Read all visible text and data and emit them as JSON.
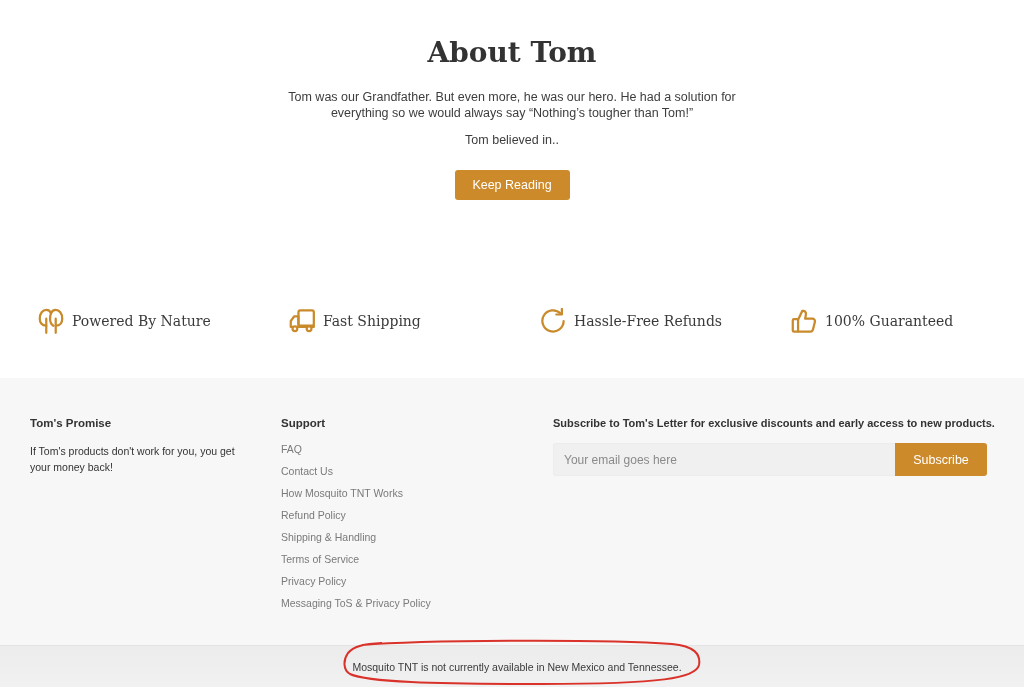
{
  "about": {
    "title": "About Tom",
    "paragraphs": [
      "Tom was our Grandfather. But even more, he was our hero. He had a solution for everything so we would always say “Nothing’s tougher than Tom!”",
      "Tom believed in.."
    ],
    "button": "Keep Reading"
  },
  "features": [
    {
      "kind": "trees",
      "label": "Powered By Nature"
    },
    {
      "kind": "truck",
      "label": "Fast Shipping"
    },
    {
      "kind": "refresh",
      "label": "Hassle-Free Refunds"
    },
    {
      "kind": "thumbs",
      "label": "100% Guaranteed"
    }
  ],
  "footer": {
    "promise": {
      "heading": "Tom's Promise",
      "text": "If Tom's products don't work for you, you get your money back!"
    },
    "support": {
      "heading": "Support",
      "links": [
        "FAQ",
        "Contact Us",
        "How Mosquito TNT Works",
        "Refund Policy",
        "Shipping & Handling",
        "Terms of Service",
        "Privacy Policy",
        "Messaging ToS & Privacy Policy"
      ]
    },
    "newsletter": {
      "heading": "Subscribe to Tom's Letter for exclusive discounts and early access to new products.",
      "placeholder": "Your email goes here",
      "button": "Subscribe"
    }
  },
  "notice": {
    "text": "Mosquito TNT is not currently available in New Mexico and Tennessee.",
    "circled": true
  }
}
